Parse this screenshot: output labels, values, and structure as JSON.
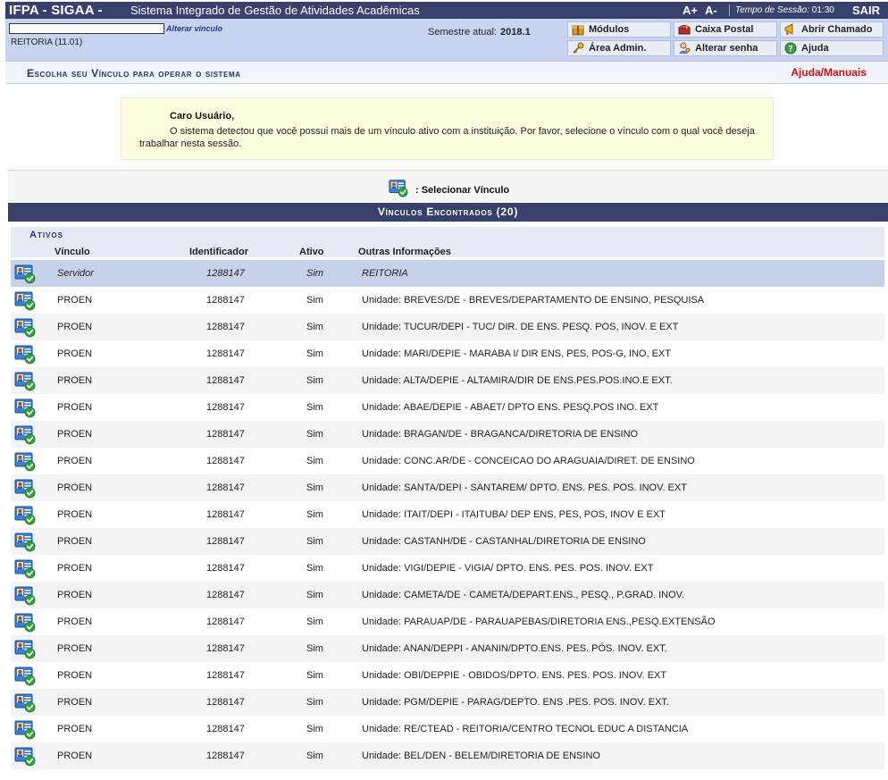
{
  "topbar": {
    "brand": "IFPA - SIGAA -",
    "subtitle": "Sistema Integrado de Gestão de Atividades Acadêmicas",
    "font_increase": "A+",
    "font_decrease": "A-",
    "session_label": "Tempo de Sessão:",
    "session_time": "01:30",
    "exit": "SAIR"
  },
  "infobar": {
    "alter_vinculo": "Alterar vínculo",
    "unit": "REITORIA (11.01)",
    "semestre_label": "Semestre atual:",
    "semestre_value": "2018.1",
    "buttons": {
      "modulos": "Módulos",
      "caixa_postal": "Caixa Postal",
      "abrir_chamado": "Abrir Chamado",
      "area_admin": "Área Admin.",
      "alterar_senha": "Alterar senha",
      "ajuda": "Ajuda"
    }
  },
  "section": {
    "title": "Escolha seu Vínculo para operar o sistema",
    "help": "Ajuda/Manuais"
  },
  "message": {
    "heading": "Caro Usuário,",
    "body": "O sistema detectou que você possui mais de um vínculo ativo com a instituição. Por favor, selecione o vínculo com o qual você deseja trabalhar nesta sessão."
  },
  "select_label": ": Selecionar Vínculo",
  "table": {
    "title": "Vínculos Encontrados (20)",
    "group": "Ativos",
    "columns": [
      "Vínculo",
      "Identificador",
      "Ativo",
      "Outras Informações"
    ],
    "rows": [
      {
        "vinculo": "Servidor",
        "id": "1288147",
        "ativo": "Sim",
        "info": "REITORIA"
      },
      {
        "vinculo": "PROEN",
        "id": "1288147",
        "ativo": "Sim",
        "info": "Unidade: BREVES/DE - BREVES/DEPARTAMENTO DE ENSINO, PESQUISA"
      },
      {
        "vinculo": "PROEN",
        "id": "1288147",
        "ativo": "Sim",
        "info": "Unidade: TUCUR/DEPI - TUC/ DIR. DE ENS. PESQ. POS, INOV. E EXT"
      },
      {
        "vinculo": "PROEN",
        "id": "1288147",
        "ativo": "Sim",
        "info": "Unidade: MARI/DEPIE - MARABA I/ DIR ENS, PES, POS-G, INO, EXT"
      },
      {
        "vinculo": "PROEN",
        "id": "1288147",
        "ativo": "Sim",
        "info": "Unidade: ALTA/DEPIE - ALTAMIRA/DIR DE ENS.PES.POS.INO.E EXT."
      },
      {
        "vinculo": "PROEN",
        "id": "1288147",
        "ativo": "Sim",
        "info": "Unidade: ABAE/DEPIE - ABAET/ DPTO ENS. PESQ.POS INO. EXT"
      },
      {
        "vinculo": "PROEN",
        "id": "1288147",
        "ativo": "Sim",
        "info": "Unidade: BRAGAN/DE - BRAGANCA/DIRETORIA DE ENSINO"
      },
      {
        "vinculo": "PROEN",
        "id": "1288147",
        "ativo": "Sim",
        "info": "Unidade: CONC.AR/DE - CONCEICAO DO ARAGUAIA/DIRET. DE ENSINO"
      },
      {
        "vinculo": "PROEN",
        "id": "1288147",
        "ativo": "Sim",
        "info": "Unidade: SANTA/DEPI - SANTAREM/ DPTO. ENS. PES. POS. INOV. EXT"
      },
      {
        "vinculo": "PROEN",
        "id": "1288147",
        "ativo": "Sim",
        "info": "Unidade: ITAIT/DEPI - ITAITUBA/ DEP ENS, PES, POS, INOV E EXT"
      },
      {
        "vinculo": "PROEN",
        "id": "1288147",
        "ativo": "Sim",
        "info": "Unidade: CASTANH/DE - CASTANHAL/DIRETORIA DE ENSINO"
      },
      {
        "vinculo": "PROEN",
        "id": "1288147",
        "ativo": "Sim",
        "info": "Unidade: VIGI/DEPIE - VIGIA/ DPTO. ENS. PES. POS. INOV. EXT"
      },
      {
        "vinculo": "PROEN",
        "id": "1288147",
        "ativo": "Sim",
        "info": "Unidade: CAMETA/DE - CAMETA/DEPART.ENS., PESQ., P.GRAD. INOV."
      },
      {
        "vinculo": "PROEN",
        "id": "1288147",
        "ativo": "Sim",
        "info": "Unidade: PARAUAP/DE - PARAUAPEBAS/DIRETORIA ENS.,PESQ.EXTENSÃO"
      },
      {
        "vinculo": "PROEN",
        "id": "1288147",
        "ativo": "Sim",
        "info": "Unidade: ANAN/DEPPI - ANANIN/DPTO.ENS. PES. PÓS. INOV. EXT."
      },
      {
        "vinculo": "PROEN",
        "id": "1288147",
        "ativo": "Sim",
        "info": "Unidade: OBI/DEPPIE - OBIDOS/DPTO. ENS. PES. POS. INOV. EXT"
      },
      {
        "vinculo": "PROEN",
        "id": "1288147",
        "ativo": "Sim",
        "info": "Unidade: PGM/DEPIE - PARAG/DEPTO. ENS .PES. POS. INOV. EXT."
      },
      {
        "vinculo": "PROEN",
        "id": "1288147",
        "ativo": "Sim",
        "info": "Unidade: RE/CTEAD - REITORIA/CENTRO TECNOL EDUC A DISTANCIA"
      },
      {
        "vinculo": "PROEN",
        "id": "1288147",
        "ativo": "Sim",
        "info": "Unidade: BEL/DEN - BELEM/DIRETORIA DE ENSINO"
      }
    ]
  },
  "colors": {
    "header_bg": "#37416b",
    "info_bg": "#c8d3ef",
    "selected_row": "#c6d2ea",
    "help_red": "#d01010"
  },
  "icons": {
    "vinculo_row": "user-card-check-icon",
    "modulos": "package-icon",
    "caixa_postal": "mailbox-icon",
    "abrir_chamado": "megaphone-icon",
    "area_admin": "key-icon",
    "alterar_senha": "user-key-icon",
    "ajuda": "help-icon"
  }
}
